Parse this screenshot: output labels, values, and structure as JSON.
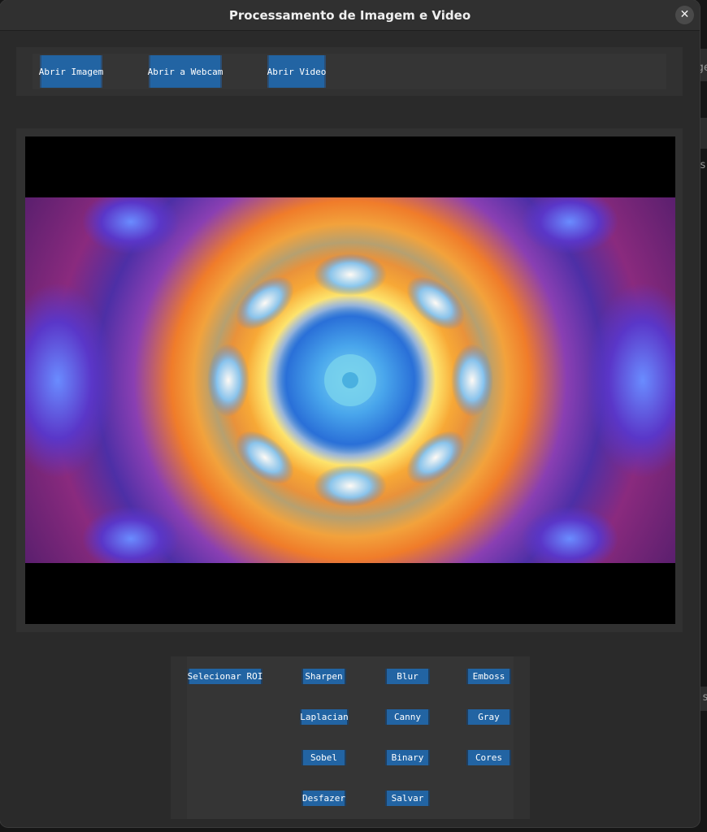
{
  "window": {
    "title": "Processamento de Imagem e Video",
    "close_glyph": "✕"
  },
  "top_toolbar": {
    "open_image": "Abrir Imagem",
    "open_webcam": "Abrir a Webcam",
    "open_video": "Abrir Video"
  },
  "filters": {
    "select_roi": "Selecionar ROI",
    "sharpen": "Sharpen",
    "blur": "Blur",
    "emboss": "Emboss",
    "laplacian": "Laplacian",
    "canny": "Canny",
    "gray": "Gray",
    "sobel": "Sobel",
    "binary": "Binary",
    "cores": "Cores",
    "desfazer": "Desfazer",
    "salvar": "Salvar"
  },
  "background_fragments": {
    "frag1": "ge",
    "frag2": "s",
    "frag3": "s"
  },
  "colors": {
    "button": "#2264a3",
    "window_bg": "#2a2a2a",
    "titlebar": "#303030"
  },
  "icons": {
    "close": "close-icon"
  }
}
